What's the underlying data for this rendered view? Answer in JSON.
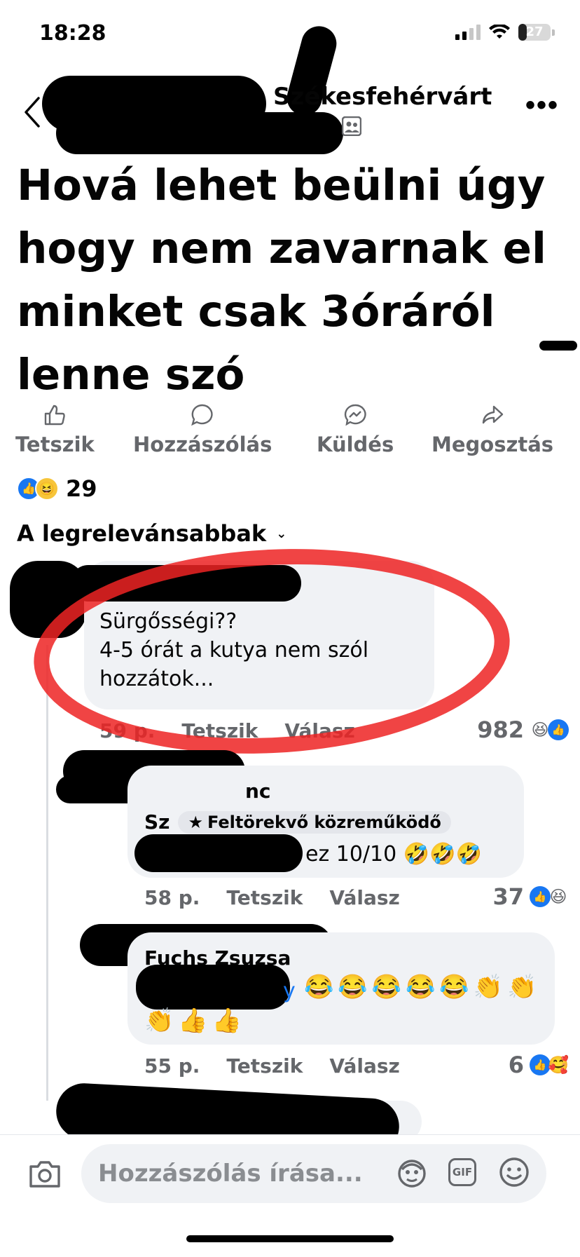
{
  "status_bar": {
    "time": "18:28",
    "battery": "27",
    "battery_level": 0.27
  },
  "header": {
    "group_name": "Székesfehérvárt",
    "back_icon": "chevron-left-icon",
    "more_label": "•••"
  },
  "post": {
    "title": "Hová lehet beülni úgy hogy nem zavarnak el minket csak 3óráról lenne szó"
  },
  "actions": [
    {
      "label": "Tetszik",
      "icon": "like-icon"
    },
    {
      "label": "Hozzászólás",
      "icon": "comment-icon"
    },
    {
      "label": "Küldés",
      "icon": "messenger-icon"
    },
    {
      "label": "Megosztás",
      "icon": "share-icon"
    }
  ],
  "reactions": {
    "count": "29",
    "icons": [
      "like",
      "haha"
    ]
  },
  "sort": {
    "label": "A legrelevánsabbak"
  },
  "comments": [
    {
      "text_lines": [
        "Sürgősségi??",
        "4-5 órát a kutya nem szól",
        "hozzátok..."
      ],
      "time": "59 p.",
      "like_label": "Tetszik",
      "reply_label": "Válasz",
      "reaction_count": "982"
    },
    {
      "name_partial": "nc",
      "badge_prefix": "Sz",
      "badge": "Feltörekvő közreműködő",
      "text": "ez 10/10",
      "emojis": "🤣🤣🤣",
      "time": "58 p.",
      "like_label": "Tetszik",
      "reply_label": "Válasz",
      "reaction_count": "37"
    },
    {
      "name": "Fuchs Zsuzsa",
      "mention_partial": "y",
      "emojis_line1": "😂😂😂😂😂👏👏",
      "emojis_line2": "👏👍👍",
      "time": "55 p.",
      "like_label": "Tetszik",
      "reply_label": "Válasz",
      "reaction_count": "6"
    }
  ],
  "composer": {
    "placeholder": "Hozzászólás írása..."
  },
  "colors": {
    "accent": "#1877f2",
    "annotation_red": "#ed2323",
    "muted": "#65676b"
  }
}
